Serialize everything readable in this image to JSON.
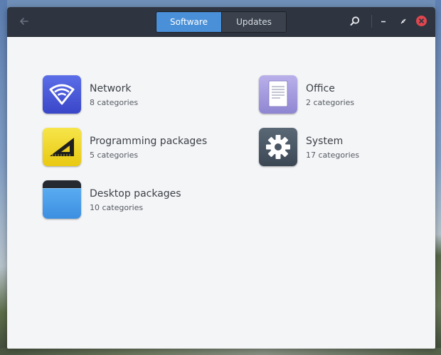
{
  "header": {
    "back_icon": "arrow-left-icon",
    "tabs": [
      {
        "label": "Software",
        "active": true
      },
      {
        "label": "Updates",
        "active": false
      }
    ],
    "actions": [
      "search-icon",
      "minimize-icon",
      "restore-icon",
      "close-icon"
    ]
  },
  "categories": [
    {
      "title": "Network",
      "subtitle": "8 categories",
      "icon": "wifi-icon"
    },
    {
      "title": "Office",
      "subtitle": "2 categories",
      "icon": "document-icon"
    },
    {
      "title": "Programming packages",
      "subtitle": "5 categories",
      "icon": "set-square-icon"
    },
    {
      "title": "System",
      "subtitle": "17 categories",
      "icon": "gear-icon"
    },
    {
      "title": "Desktop packages",
      "subtitle": "10 categories",
      "icon": "window-icon"
    }
  ],
  "colors": {
    "accent": "#4a90d9",
    "header_bg": "#2f3540",
    "content_bg": "#f4f5f7",
    "close": "#e0464e"
  }
}
